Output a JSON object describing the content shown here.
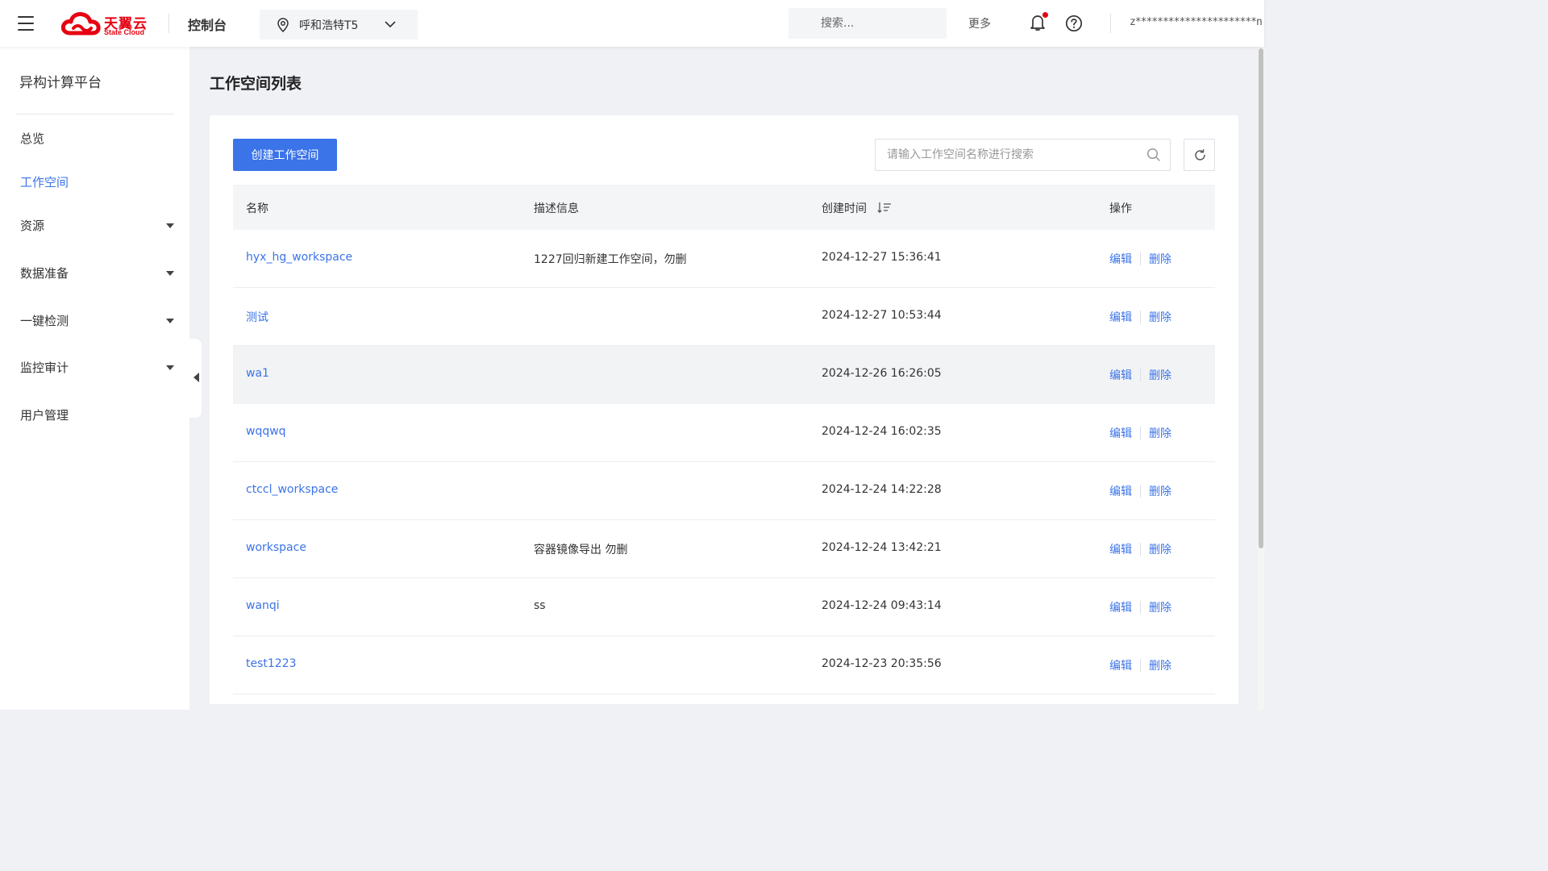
{
  "header": {
    "logo_cn": "天翼云",
    "logo_en": "State Cloud",
    "console_label": "控制台",
    "region": "呼和浩特T5",
    "search_placeholder": "搜索...",
    "more_label": "更多",
    "username": "z**********************n",
    "brand_color": "#e60012"
  },
  "sidebar": {
    "title": "异构计算平台",
    "items": [
      {
        "label": "总览",
        "active": false,
        "expandable": false
      },
      {
        "label": "工作空间",
        "active": true,
        "expandable": false
      },
      {
        "label": "资源",
        "active": false,
        "expandable": true
      },
      {
        "label": "数据准备",
        "active": false,
        "expandable": true
      },
      {
        "label": "一键检测",
        "active": false,
        "expandable": true
      },
      {
        "label": "监控审计",
        "active": false,
        "expandable": true
      },
      {
        "label": "用户管理",
        "active": false,
        "expandable": false
      }
    ]
  },
  "main": {
    "page_title": "工作空间列表",
    "create_button": "创建工作空间",
    "search_placeholder": "请输入工作空间名称进行搜索",
    "accent_color": "#3b73e8",
    "table": {
      "columns": [
        "名称",
        "描述信息",
        "创建时间",
        "操作"
      ],
      "edit_label": "编辑",
      "delete_label": "删除",
      "rows": [
        {
          "name": "hyx_hg_workspace",
          "description": "1227回归新建工作空间，勿删",
          "created": "2024-12-27 15:36:41"
        },
        {
          "name": "测试",
          "description": "",
          "created": "2024-12-27 10:53:44"
        },
        {
          "name": "wa1",
          "description": "",
          "created": "2024-12-26 16:26:05"
        },
        {
          "name": "wqqwq",
          "description": "",
          "created": "2024-12-24 16:02:35"
        },
        {
          "name": "ctccl_workspace",
          "description": "",
          "created": "2024-12-24 14:22:28"
        },
        {
          "name": "workspace",
          "description": "容器镜像导出 勿删",
          "created": "2024-12-24 13:42:21"
        },
        {
          "name": "wanqi",
          "description": "ss",
          "created": "2024-12-24 09:43:14"
        },
        {
          "name": "test1223",
          "description": "",
          "created": "2024-12-23 20:35:56"
        }
      ]
    }
  }
}
